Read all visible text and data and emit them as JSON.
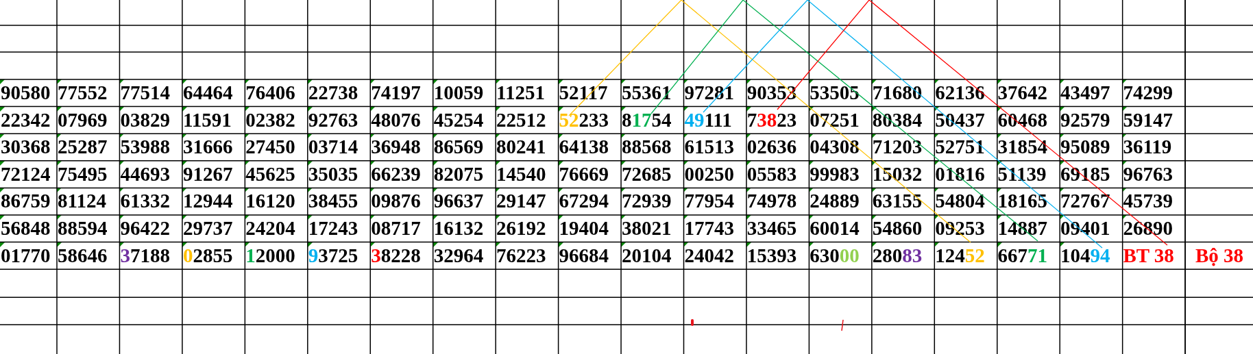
{
  "sheet": {
    "rows": [
      {
        "cells": [
          "90580",
          "77552",
          "77514",
          "64464",
          "76406",
          "22738",
          "74197",
          "10059",
          "11251",
          "52117",
          "55361",
          "97281",
          "90353",
          "53505",
          "71680",
          "62136",
          "37642",
          "43497",
          "74299"
        ]
      },
      {
        "cells": [
          "22342",
          "07969",
          "03829",
          "11591",
          "02382",
          "92763",
          "48076",
          "45254",
          "22512",
          {
            "flag": true,
            "parts": [
              {
                "text": "52",
                "color": "#ffc000"
              },
              {
                "text": "233"
              }
            ]
          },
          {
            "flag": true,
            "parts": [
              {
                "text": "8"
              },
              {
                "text": "17",
                "color": "#00b050"
              },
              {
                "text": "54"
              }
            ]
          },
          {
            "flag": true,
            "parts": [
              {
                "text": "49",
                "color": "#00b0f0"
              },
              {
                "text": "111"
              }
            ]
          },
          {
            "flag": true,
            "parts": [
              {
                "text": "7"
              },
              {
                "text": "38",
                "color": "#ff0000"
              },
              {
                "text": "23"
              }
            ]
          },
          "07251",
          "80384",
          "50437",
          "60468",
          "92579",
          "59147"
        ]
      },
      {
        "cells": [
          "30368",
          "25287",
          "53988",
          "31666",
          "27450",
          "03714",
          "36948",
          "86569",
          "80241",
          "64138",
          "88568",
          "61513",
          "02636",
          "04308",
          "71203",
          "52751",
          "31854",
          "95089",
          "36119"
        ]
      },
      {
        "cells": [
          "72124",
          "75495",
          "44693",
          "91267",
          "45625",
          "35035",
          "66239",
          "82075",
          "14540",
          "76669",
          "72685",
          "00250",
          "05583",
          "99983",
          "15032",
          "01816",
          "51139",
          "69185",
          "96763"
        ]
      },
      {
        "cells": [
          "86759",
          "81124",
          "61332",
          "12944",
          "16120",
          "38455",
          "09876",
          "96637",
          "29147",
          "67294",
          "72939",
          "77954",
          "74978",
          "24889",
          "63155",
          "54804",
          "18165",
          "72767",
          "45739"
        ]
      },
      {
        "cells": [
          "56848",
          "88594",
          "96422",
          "29737",
          "24204",
          "17243",
          "08717",
          "16132",
          "26192",
          "19404",
          "38021",
          "17743",
          "33465",
          "60014",
          "54860",
          "09253",
          "14887",
          "09401",
          "26890"
        ]
      },
      {
        "cells": [
          "01770",
          "58646",
          {
            "flag": true,
            "parts": [
              {
                "text": "3",
                "color": "#7030a0"
              },
              {
                "text": "7188"
              }
            ]
          },
          {
            "flag": true,
            "parts": [
              {
                "text": "0",
                "color": "#ffc000"
              },
              {
                "text": "2855"
              }
            ]
          },
          {
            "flag": true,
            "parts": [
              {
                "text": "1",
                "color": "#00b050"
              },
              {
                "text": "2000"
              }
            ]
          },
          {
            "flag": true,
            "parts": [
              {
                "text": "9",
                "color": "#00b0f0"
              },
              {
                "text": "3725"
              }
            ]
          },
          {
            "flag": true,
            "parts": [
              {
                "text": "3",
                "color": "#ff0000"
              },
              {
                "text": "8228"
              }
            ]
          },
          "32964",
          "76223",
          "96684",
          "20104",
          "24042",
          "15393",
          {
            "flag": true,
            "parts": [
              {
                "text": "630"
              },
              {
                "text": "00",
                "color": "#92d050"
              }
            ]
          },
          {
            "flag": true,
            "parts": [
              {
                "text": "280"
              },
              {
                "text": "83",
                "color": "#7030a0"
              }
            ]
          },
          {
            "flag": true,
            "parts": [
              {
                "text": "124"
              },
              {
                "text": "52",
                "color": "#ffc000"
              }
            ]
          },
          {
            "flag": true,
            "parts": [
              {
                "text": "667"
              },
              {
                "text": "71",
                "color": "#00b050"
              }
            ]
          },
          {
            "flag": true,
            "parts": [
              {
                "text": "104"
              },
              {
                "text": "94",
                "color": "#00b0f0"
              }
            ]
          },
          {
            "flag": false,
            "parts": [
              {
                "text": "BT 38",
                "color": "#ff0000"
              }
            ]
          },
          {
            "flag": false,
            "parts": [
              {
                "text": "Bộ 38",
                "color": "#ff0000"
              }
            ]
          }
        ]
      }
    ]
  },
  "annotation_lines": [
    {
      "color": "#ffc000"
    },
    {
      "color": "#00b050"
    },
    {
      "color": "#00b0f0"
    },
    {
      "color": "#ff0000"
    }
  ]
}
